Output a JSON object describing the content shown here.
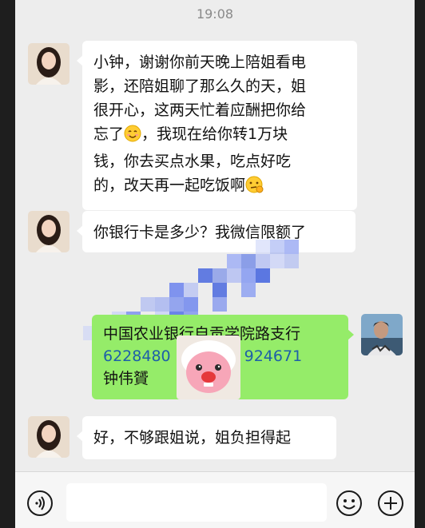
{
  "status_time": "19:08",
  "messages": [
    {
      "lines": [
        "小钟，谢谢你前天晚上陪姐看电",
        "影，还陪姐聊了那么久的天，姐",
        "很开心，这两天忙着应酬把你给",
        "忘了",
        "，我现在给你转1万块",
        "钱，你去买点水果，吃点好吃",
        "的，改天再一起吃饭啊"
      ]
    },
    {
      "text": "你银行卡是多少？我微信限额了"
    },
    {
      "lines": [
        "中国农业银行自贡学院路支行",
        "6228480",
        "924671",
        "钟伟贇"
      ]
    },
    {
      "text": "好，不够跟姐说，姐负担得起"
    }
  ],
  "icons": {
    "smile_emoji": "smile-emoji",
    "thinking_emoji": "thinking-emoji",
    "sticker": "pink-mascot-sticker"
  },
  "input": {
    "placeholder": ""
  },
  "colors": {
    "sent_bubble": "#95ec69",
    "received_bubble": "#ffffff",
    "background": "#ededed"
  }
}
